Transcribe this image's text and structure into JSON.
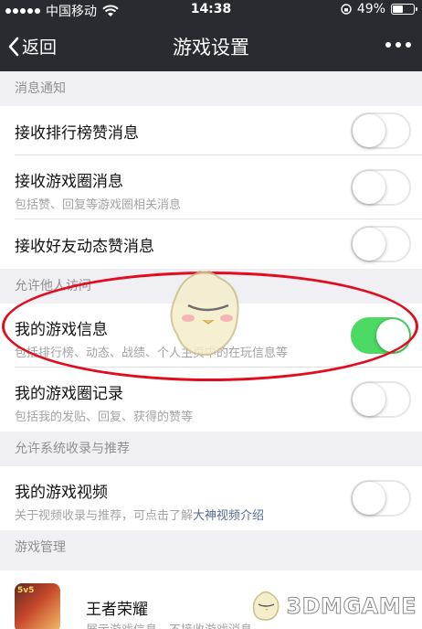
{
  "status": {
    "carrier": "中国移动",
    "time": "14:38",
    "battery": "49%",
    "battery_level": 0.49
  },
  "nav": {
    "back_label": "返回",
    "title": "游戏设置"
  },
  "sections": {
    "notify": {
      "header": "消息通知",
      "rows": [
        {
          "title": "接收排行榜赞消息",
          "on": false
        },
        {
          "title": "接收游戏圈消息",
          "subtitle": "包括赞、回复等游戏圈相关消息",
          "on": false
        },
        {
          "title": "接收好友动态赞消息",
          "on": false
        }
      ]
    },
    "access": {
      "header": "允许他人访问",
      "rows": [
        {
          "title": "我的游戏信息",
          "subtitle": "包括排行榜、动态、战绩、个人主页中的在玩信息等",
          "on": true
        },
        {
          "title": "我的游戏圈记录",
          "subtitle": "包括我的发贴、回复、获得的赞等",
          "on": false
        }
      ]
    },
    "recommend": {
      "header": "允许系统收录与推荐",
      "rows": [
        {
          "title": "我的游戏视频",
          "subtitle_prefix": "关于视频收录与推荐，可点击了解",
          "subtitle_link": "大神视频介绍",
          "on": false
        }
      ]
    },
    "manage": {
      "header": "游戏管理",
      "game": {
        "title": "王者荣耀",
        "subtitle": "展示游戏信息，不接收游戏消息",
        "icon_badge": "5v5"
      }
    }
  },
  "watermark": {
    "text": "3DMGAME"
  },
  "colors": {
    "toggle_on": "#4cd964",
    "annotation": "#e10c1e",
    "link": "#576b95"
  }
}
